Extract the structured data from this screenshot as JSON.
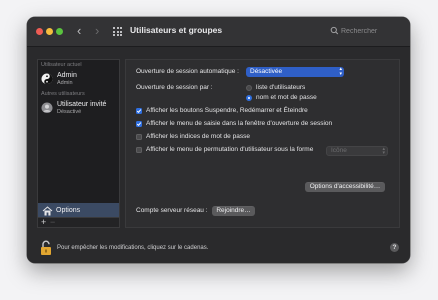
{
  "window": {
    "title": "Utilisateurs et groupes",
    "back": "‹",
    "forward": "›"
  },
  "search": {
    "placeholder": "Rechercher"
  },
  "sidebar": {
    "section_current": "Utilisateur actuel",
    "section_others": "Autres utilisateurs",
    "users": [
      {
        "name": "Admin",
        "role": "Admin"
      },
      {
        "name": "Utilisateur invité",
        "role": "Désactivé"
      }
    ],
    "options_label": "Options",
    "add": "+",
    "remove": "−"
  },
  "panel": {
    "auto_login_label": "Ouverture de session automatique :",
    "auto_login_value": "Désactivée",
    "login_as_label": "Ouverture de session par :",
    "radio_options": [
      {
        "label": "liste d'utilisateurs",
        "selected": false
      },
      {
        "label": "nom et mot de passe",
        "selected": true
      }
    ],
    "checkboxes": [
      {
        "label": "Afficher les boutons Suspendre, Redémarrer et Éteindre",
        "checked": true
      },
      {
        "label": "Afficher le menu de saisie dans la fenêtre d'ouverture de session",
        "checked": true
      },
      {
        "label": "Afficher les indices de mot de passe",
        "checked": false
      },
      {
        "label": "Afficher le menu de permutation d'utilisateur sous la forme",
        "checked": false
      }
    ],
    "fast_switch_value": "Icône",
    "accessibility_button": "Options d'accessibilité…",
    "network_server_label": "Compte serveur réseau :",
    "join_button": "Rejoindre…"
  },
  "footer": {
    "lock_text": "Pour empêcher les modifications, cliquez sur le cadenas.",
    "help": "?"
  },
  "colors": {
    "accent": "#2f6fe0",
    "selection": "#3b4a63",
    "window_bg": "#2a2a2c"
  }
}
